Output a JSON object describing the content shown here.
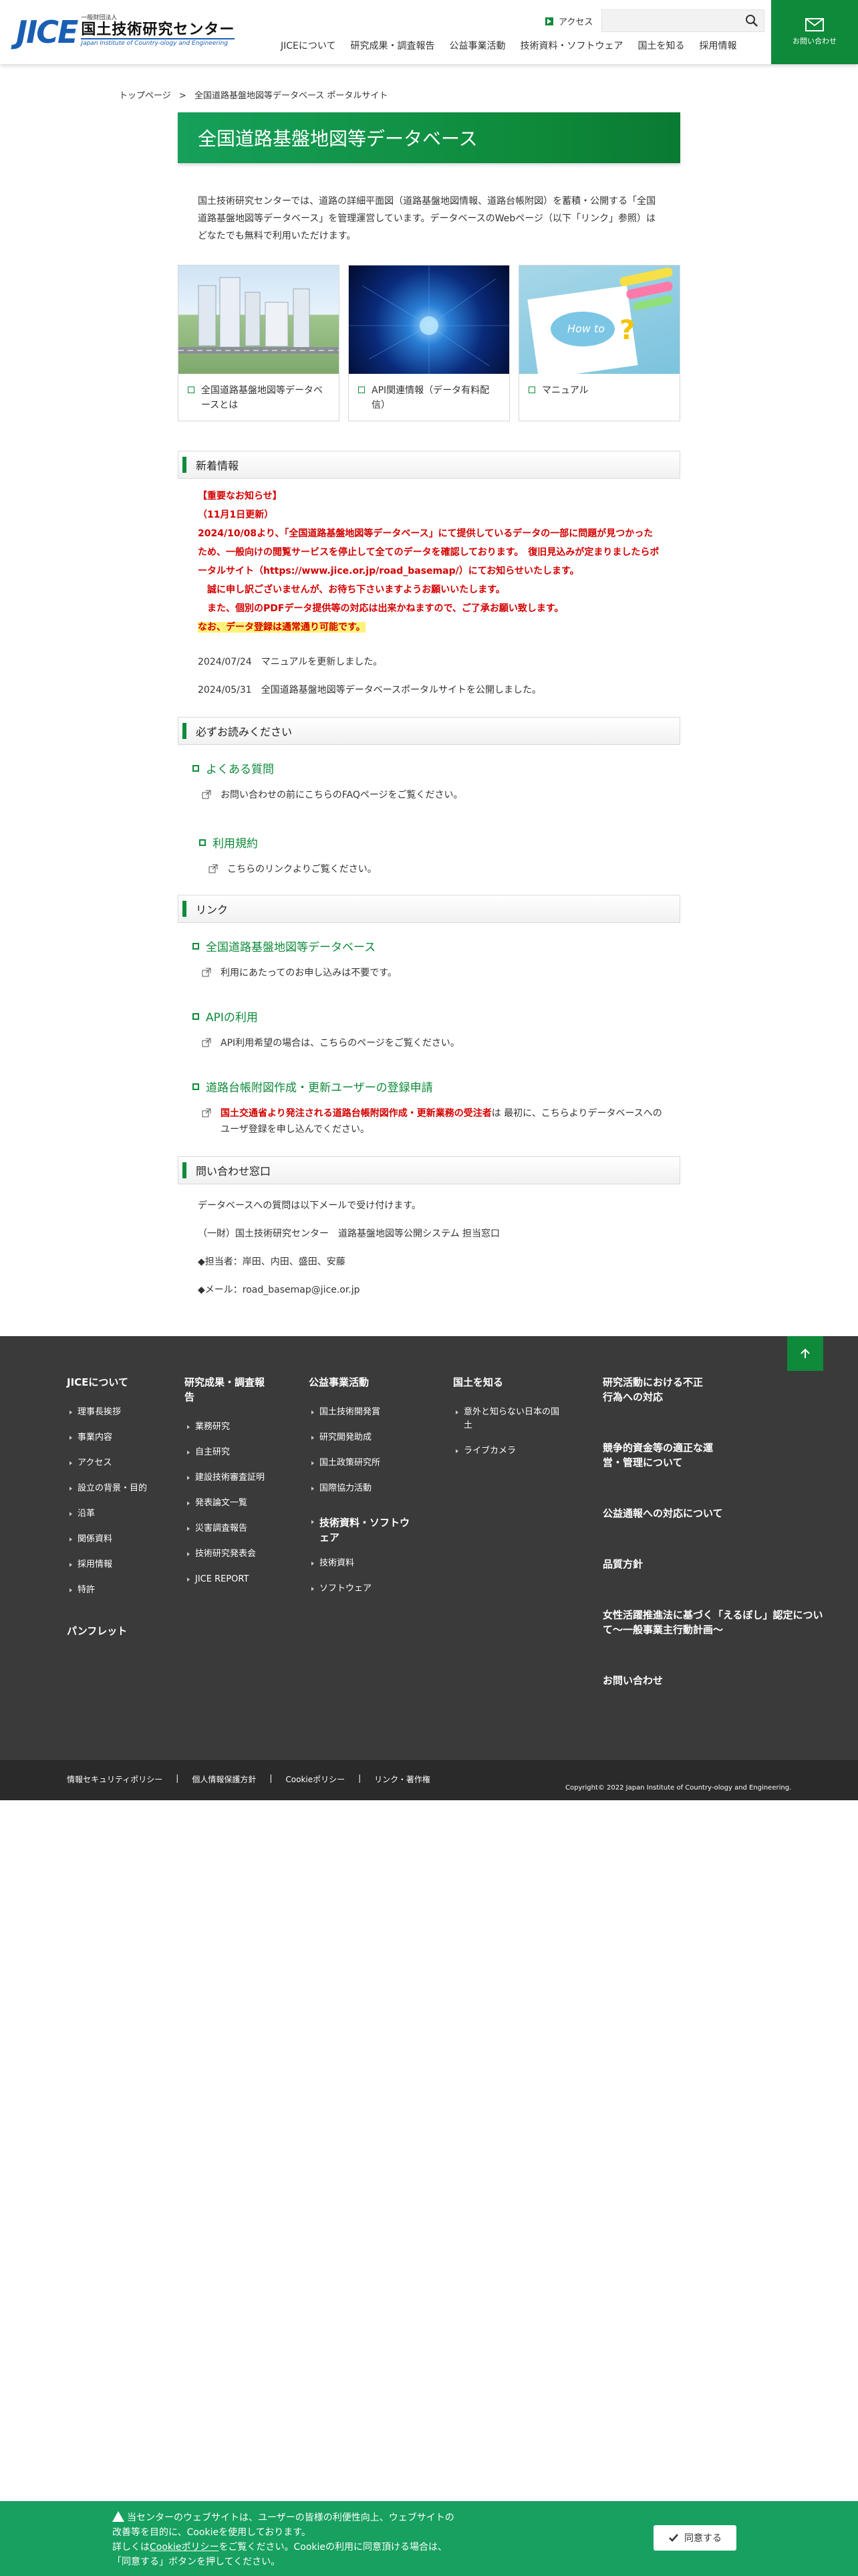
{
  "header": {
    "logo_small": "一般財団法人",
    "logo_main": "JICE",
    "logo_jp": "国土技術研究センター",
    "logo_en": "Japan Institute of Country-ology and Engineering",
    "access_label": "アクセス",
    "search_placeholder": "",
    "nav": [
      "JICEについて",
      "研究成果・調査報告",
      "公益事業活動",
      "技術資料・ソフトウェア",
      "国土を知る",
      "採用情報"
    ],
    "contact_label": "お問い合わせ"
  },
  "breadcrumb": {
    "home": "トップページ",
    "current": "全国道路基盤地図等データベース ポータルサイト"
  },
  "page": {
    "title": "全国道路基盤地図等データベース",
    "intro": "国土技術研究センターでは、道路の詳細平面図（道路基盤地図情報、道路台帳附図）を蓄積・公開する「全国道路基盤地図等データベース」を管理運営しています。データベースのWebページ（以下「リンク」参照）はどなたでも無料で利用いただけます。"
  },
  "cards": [
    {
      "label": "全国道路基盤地図等データベースとは"
    },
    {
      "label": "API関連情報（データ有料配信）"
    },
    {
      "label": "マニュアル"
    }
  ],
  "news": {
    "heading": "新着情報",
    "notice_lines": [
      "【重要なお知らせ】",
      "（11月1日更新）",
      "2024/10/08より、「全国道路基盤地図等データベース」にて提供しているデータの一部に問題が見つかったため、一般向けの閲覧サービスを停止して全てのデータを確認しております。　復旧見込みが定まりましたらポータルサイト（https://www.jice.or.jp/road_basemap/）にてお知らせいたします。",
      "　誠に申し訳ございませんが、お待ち下さいますようお願いいたします。",
      "　また、個別のPDFデータ提供等の対応は出来かねますので、ご了承お願い致します。"
    ],
    "highlight": "なお、データ登録は通常通り可能です。",
    "items": [
      {
        "date": "2024/07/24",
        "text": "マニュアルを更新しました。"
      },
      {
        "date": "2024/05/31",
        "text": "全国道路基盤地図等データベースポータルサイトを公開しました。"
      }
    ]
  },
  "must_read": {
    "heading": "必ずお読みください",
    "faq_title": "よくある質問",
    "faq_text": "お問い合わせの前にこちらのFAQページをご覧ください。",
    "terms_title": "利用規約",
    "terms_text": "こちらのリンクよりご覧ください。"
  },
  "links": {
    "heading": "リンク",
    "db_title": "全国道路基盤地図等データベース",
    "db_text": "利用にあたってのお申し込みは不要です。",
    "api_title": "APIの利用",
    "api_text": "API利用希望の場合は、こちらのページをご覧ください。",
    "reg_title": "道路台帳附図作成・更新ユーザーの登録申請",
    "reg_red": "国土交通省より発注される道路台帳附図作成・更新業務の受注者",
    "reg_text": "は 最初に、こちらよりデータベースへのユーザ登録を申し込んでください。"
  },
  "contact": {
    "heading": "問い合わせ窓口",
    "line1": "データベースへの質問は以下メールで受け付けます。",
    "line2": "（一財）国土技術研究センター　道路基盤地図等公開システム 担当窓口",
    "line3": "◆担当者：岸田、内田、盛田、安藤",
    "line4": "◆メール：road_basemap@jice.or.jp"
  },
  "footer": {
    "col1_title": "JICEについて",
    "col1_items": [
      "理事長挨拶",
      "事業内容",
      "アクセス",
      "設立の背景・目的",
      "沿革",
      "関係資料",
      "採用情報",
      "特許"
    ],
    "col1_extra": "パンフレット",
    "col2_title": "研究成果・調査報告",
    "col2_items": [
      "業務研究",
      "自主研究",
      "建設技術審査証明",
      "発表論文一覧",
      "災害調査報告",
      "技術研究発表会",
      "JICE REPORT"
    ],
    "col3_title": "公益事業活動",
    "col3_items": [
      "国土技術開発賞",
      "研究開発助成",
      "国土政策研究所",
      "国際協力活動"
    ],
    "col3b_title": "技術資料・ソフトウェア",
    "col3b_items": [
      "技術資料",
      "ソフトウェア"
    ],
    "col4_title": "国土を知る",
    "col4_items": [
      "意外と知らない日本の国土",
      "ライブカメラ"
    ],
    "right_items": [
      "研究活動における不正行為への対応",
      "競争的資金等の適正な運営・管理について",
      "公益通報への対応について",
      "品質方針",
      "女性活躍推進法に基づく「えるぼし」認定について〜一般事業主行動計画〜",
      "お問い合わせ"
    ],
    "bottom_links": [
      "情報セキュリティポリシー",
      "個人情報保護方針",
      "Cookieポリシー",
      "リンク・著作権"
    ],
    "copyright": "Copyright© 2022 Japan Institute of Country-ology and Engineering."
  },
  "cookie": {
    "line1": "当センターのウェブサイトは、ユーザーの皆様の利便性向上、ウェブサイトの",
    "line2": "改善等を目的に、Cookieを使用しております。",
    "line3_pre": "詳しくは",
    "line3_link": "Cookieポリシー",
    "line3_post": "をご覧ください。Cookieの利用に同意頂ける場合は、",
    "line4": "「同意する」ボタンを押してください。",
    "agree_label": "同意する"
  }
}
